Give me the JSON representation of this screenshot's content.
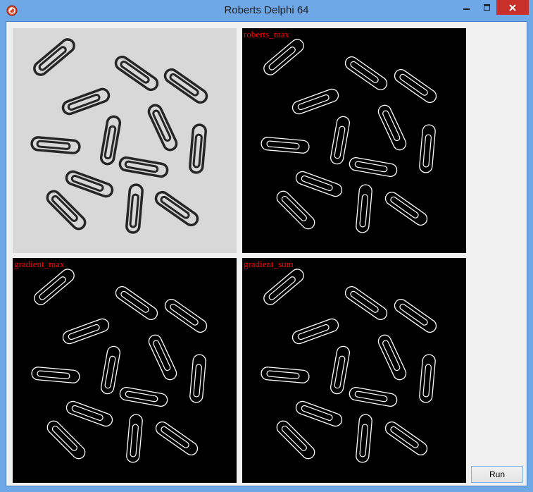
{
  "window": {
    "title": "Roberts  Delphi 64",
    "icons": {
      "app": "app-icon",
      "minimize": "minimize-icon",
      "maximize": "maximize-icon",
      "close": "close-icon"
    },
    "colors": {
      "frame": "#6fa8e6",
      "close": "#c7302b",
      "client": "#f0f0f0",
      "label": "#ff0000"
    }
  },
  "panels": [
    {
      "id": "original",
      "label": ""
    },
    {
      "id": "roberts_max",
      "label": "roberts_max"
    },
    {
      "id": "gradient_max",
      "label": "gradient_max"
    },
    {
      "id": "gradient_sum",
      "label": "gradient_sum"
    }
  ],
  "buttons": {
    "run_label": "Run"
  }
}
